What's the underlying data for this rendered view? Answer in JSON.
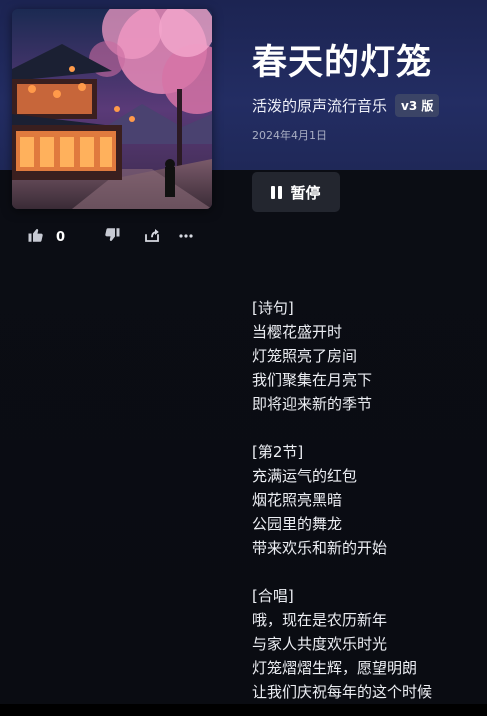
{
  "song": {
    "title": "春天的灯笼",
    "style": "活泼的原声流行音乐",
    "version": "v3 版",
    "date": "2024年4月1日"
  },
  "player": {
    "pause_label": "暂停"
  },
  "actions": {
    "likes": "0"
  },
  "icons": {
    "like": "thumbs-up-icon",
    "dislike": "thumbs-down-icon",
    "share": "share-icon",
    "more": "more-icon",
    "pause": "pause-icon"
  },
  "colors": {
    "header": "#232d63",
    "background": "#0b0d13",
    "badge": "#3b4466"
  },
  "lyrics": {
    "verse_tag": "[诗句]",
    "verse": [
      "当樱花盛开时",
      "灯笼照亮了房间",
      "我们聚集在月亮下",
      "即将迎来新的季节"
    ],
    "section2_tag": "[第2节]",
    "section2": [
      "充满运气的红包",
      "烟花照亮黑暗",
      "公园里的舞龙",
      "带来欢乐和新的开始"
    ],
    "chorus_tag": "[合唱]",
    "chorus": [
      "哦，现在是农历新年",
      "与家人共度欢乐时光",
      "灯笼熠熠生辉，愿望明朗",
      "让我们庆祝每年的这个时候"
    ]
  }
}
